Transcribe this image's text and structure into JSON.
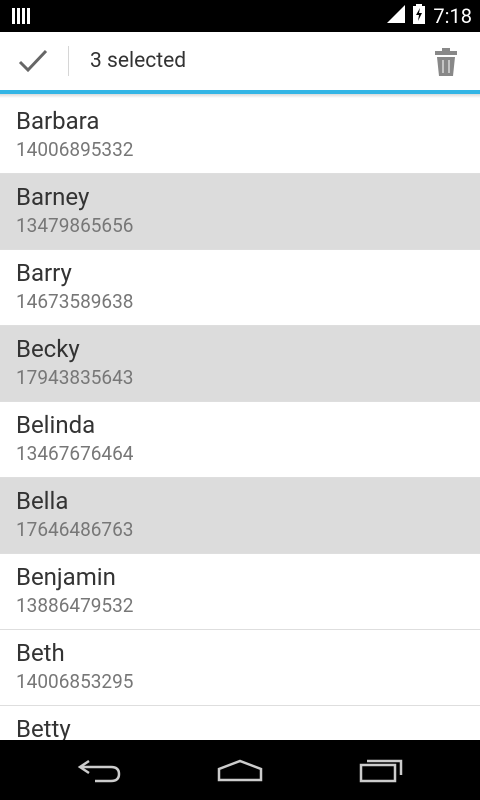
{
  "status_bar": {
    "time": "7:18",
    "icons": [
      "notification-icon",
      "signal-icon",
      "battery-charging-icon"
    ]
  },
  "action_bar": {
    "title": "3 selected",
    "done_icon": "check-icon",
    "delete_icon": "trash-icon",
    "accent_color": "#33b5e5"
  },
  "contacts": [
    {
      "name": "Barbara",
      "phone": "14006895332",
      "selected": false
    },
    {
      "name": "Barney",
      "phone": "13479865656",
      "selected": true
    },
    {
      "name": "Barry",
      "phone": "14673589638",
      "selected": false
    },
    {
      "name": "Becky",
      "phone": "17943835643",
      "selected": true
    },
    {
      "name": "Belinda",
      "phone": "13467676464",
      "selected": false
    },
    {
      "name": "Bella",
      "phone": "17646486763",
      "selected": true
    },
    {
      "name": "Benjamin",
      "phone": "13886479532",
      "selected": false
    },
    {
      "name": "Beth",
      "phone": "14006853295",
      "selected": false
    },
    {
      "name": "Betty",
      "phone": "",
      "selected": false
    }
  ],
  "nav_bar": {
    "icons": [
      "back-icon",
      "home-icon",
      "recent-apps-icon"
    ]
  }
}
